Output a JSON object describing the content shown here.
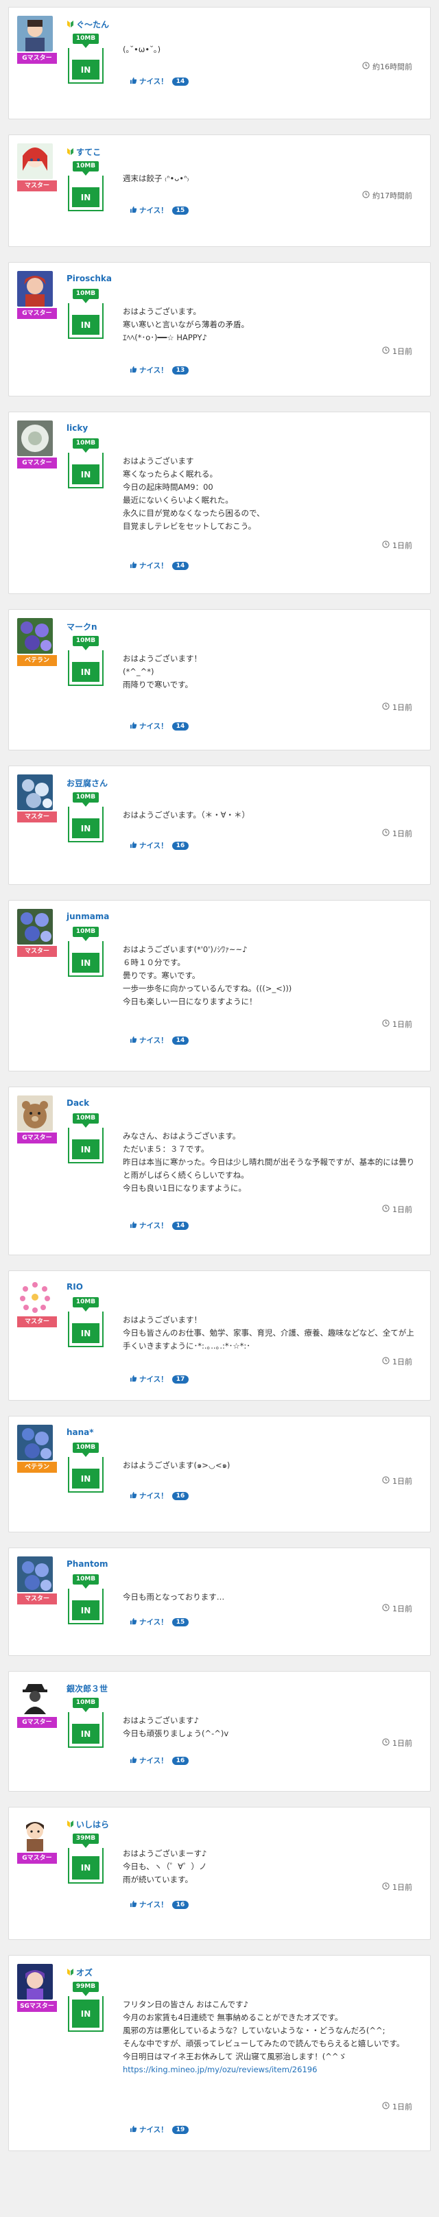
{
  "data_meter_label": "IN",
  "like_label": "ナイス！",
  "posts": [
    {
      "name": "ぐ～たん",
      "beginner": true,
      "badge": "Gマスター",
      "badge_type": "g",
      "data": "10MB",
      "text": "(｡˘•ω•˘｡)",
      "time": "約16時間前",
      "likes": "14",
      "avatar": "a1"
    },
    {
      "name": "すてこ",
      "beginner": true,
      "badge": "マスター",
      "badge_type": "m",
      "data": "10MB",
      "text": "週末は餃子 ₍ᐢ•ᴗ•ᐢ₎",
      "time": "約17時間前",
      "likes": "15",
      "avatar": "a2"
    },
    {
      "name": "Piroschka",
      "beginner": false,
      "badge": "Gマスター",
      "badge_type": "g",
      "data": "10MB",
      "text": "おはようございます。\n寒い寒いと言いながら薄着の矛盾。\nｴﾍﾍ(*･o･)━━☆ HAPPY♪",
      "time": "1日前",
      "likes": "13",
      "avatar": "a3"
    },
    {
      "name": "licky",
      "beginner": false,
      "badge": "Gマスター",
      "badge_type": "g",
      "data": "10MB",
      "text": "おはようございます\n寒くなったらよく眠れる。\n今日の起床時間AM9：00\n最近にないくらいよく眠れた。\n永久に目が覚めなくなったら困るので、\n目覚ましテレビをセットしておこう。",
      "time": "1日前",
      "likes": "14",
      "avatar": "a4"
    },
    {
      "name": "マークn",
      "beginner": false,
      "badge": "ベテラン",
      "badge_type": "v",
      "data": "10MB",
      "text": "おはようございます！\n(*^_^*)\n雨降りで寒いです。",
      "time": "1日前",
      "likes": "14",
      "avatar": "a5"
    },
    {
      "name": "お豆腐さん",
      "beginner": false,
      "badge": "マスター",
      "badge_type": "m",
      "data": "10MB",
      "text": "おはようございます。（＊・∀・＊）",
      "time": "1日前",
      "likes": "16",
      "avatar": "a6"
    },
    {
      "name": "junmama",
      "beginner": false,
      "badge": "マスター",
      "badge_type": "m",
      "data": "10MB",
      "text": "おはようございます(*'0')ﾉｼﾜｧ~~♪\n６時１０分です。\n曇りです。寒いです。\n一歩一歩冬に向かっているんですね。(((>_<)))\n今日も楽しい一日になりますように！",
      "time": "1日前",
      "likes": "14",
      "avatar": "a7"
    },
    {
      "name": "Dack",
      "beginner": false,
      "badge": "Gマスター",
      "badge_type": "g",
      "data": "10MB",
      "text": "みなさん、おはようございます。\nただいま５：３７です。\n昨日は本当に寒かった。今日は少し晴れ間が出そうな予報ですが、基本的には曇りと雨がしばらく続くらしいですね。\n今日も良い1日になりますように。",
      "time": "1日前",
      "likes": "14",
      "avatar": "a8"
    },
    {
      "name": "RIO",
      "beginner": false,
      "badge": "マスター",
      "badge_type": "m",
      "data": "10MB",
      "text": "おはようございます！\n今日も皆さんのお仕事、勉学、家事、育児、介護、療養、趣味などなど、全てが上手くいきますように･*:.｡..｡.:*･☆*:･",
      "time": "1日前",
      "likes": "17",
      "avatar": "a9"
    },
    {
      "name": "hana*",
      "beginner": false,
      "badge": "ベテラン",
      "badge_type": "v",
      "data": "10MB",
      "text": "おはようございます(๑>◡<๑)",
      "time": "1日前",
      "likes": "16",
      "avatar": "a10"
    },
    {
      "name": "Phantom",
      "beginner": false,
      "badge": "マスター",
      "badge_type": "m",
      "data": "10MB",
      "text": "今日も雨となっております…",
      "time": "1日前",
      "likes": "15",
      "avatar": "a11"
    },
    {
      "name": "銀次郎３世",
      "beginner": false,
      "badge": "Gマスター",
      "badge_type": "g",
      "data": "10MB",
      "text": "おはようございます♪\n今日も頑張りましょう(^-^)v",
      "time": "1日前",
      "likes": "16",
      "avatar": "a12"
    },
    {
      "name": "いしはら",
      "beginner": true,
      "badge": "Gマスター",
      "badge_type": "g",
      "data": "39MB",
      "text": "おはようございまーす♪\n今日も、ヽ（゜∀゜）ノ\n雨が続いています。",
      "time": "1日前",
      "likes": "16",
      "avatar": "a13"
    },
    {
      "name": "オズ",
      "beginner": true,
      "badge": "SGマスター",
      "badge_type": "sg",
      "data": "99MB",
      "text": "フリタン日の皆さん おはこんです♪\n今月のお家賃も4日連続で 無事納めることができたオズです。\n風邪の方は悪化しているような？していないような・・どうなんだろ(^^;\nそんな中ですが、頑張ってレビューしてみたので読んでもらえると嬉しいです。\n今日明日はマイネ王お休みして 沢山寝て風邪治します！(^^ゞ",
      "link": "https://king.mineo.jp/my/ozu/reviews/item/26196",
      "time": "1日前",
      "likes": "19",
      "avatar": "a14"
    }
  ]
}
